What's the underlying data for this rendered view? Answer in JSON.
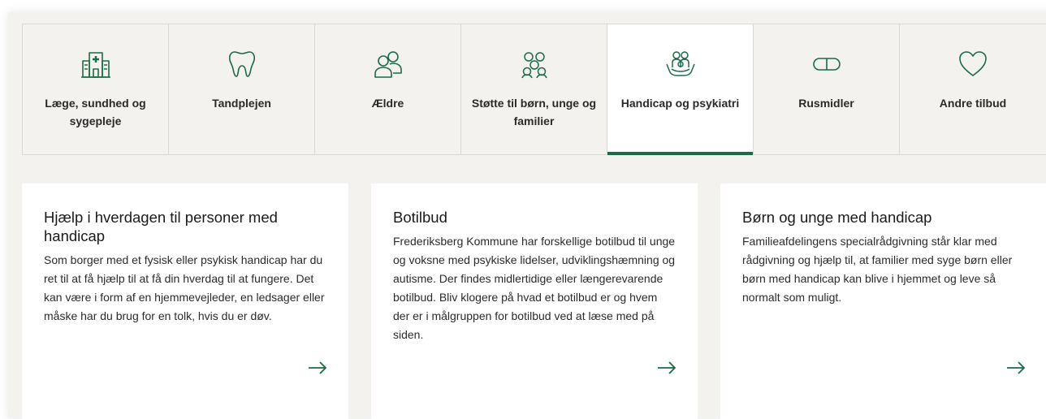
{
  "accent_color": "#1b6b45",
  "tabs": [
    {
      "label": "Læge, sundhed og sygepleje",
      "icon": "hospital-icon",
      "active": false
    },
    {
      "label": "Tandplejen",
      "icon": "tooth-icon",
      "active": false
    },
    {
      "label": "Ældre",
      "icon": "elderly-people-icon",
      "active": false
    },
    {
      "label": "Støtte til børn, unge og familier",
      "icon": "family-icon",
      "active": false
    },
    {
      "label": "Handicap og psykiatri",
      "icon": "caring-hands-icon",
      "active": true
    },
    {
      "label": "Rusmidler",
      "icon": "pill-icon",
      "active": false
    },
    {
      "label": "Andre tilbud",
      "icon": "heart-icon",
      "active": false
    }
  ],
  "cards": [
    {
      "title": "Hjælp i hverdagen til personer med handicap",
      "body": "Som borger med et fysisk eller psykisk handicap har du ret til at få hjælp til at få din hverdag til at fungere. Det kan være i form af en hjemmevejleder, en ledsager eller måske har du brug for en tolk, hvis du er døv.",
      "arrow_icon": "arrow-right-icon"
    },
    {
      "title": "Botilbud",
      "body": "Frederiksberg Kommune har forskellige botilbud til unge og voksne med psykiske lidelser, udviklingshæmning og autisme. Der findes midlertidige eller længerevarende botilbud. Bliv klogere på hvad et botilbud er og hvem der er i målgruppen for botilbud ved at læse med på siden.",
      "arrow_icon": "arrow-right-icon"
    },
    {
      "title": "Børn og unge med handicap",
      "body": "Familieafdelingens specialrådgivning står klar med rådgivning og hjælp til, at familier med syge børn eller børn med handicap kan blive i hjemmet og leve så normalt som muligt.",
      "arrow_icon": "arrow-right-icon"
    }
  ]
}
